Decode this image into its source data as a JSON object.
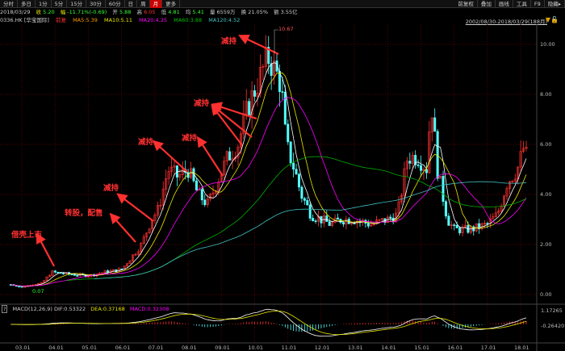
{
  "toolbar": {
    "periods": [
      "分时",
      "多日",
      "1分",
      "5分",
      "15分",
      "30分",
      "60分",
      "日",
      "周",
      "月",
      "更多"
    ],
    "active": "月",
    "right": [
      "前复权",
      "叠加",
      "画线",
      "工具",
      "F9",
      "隐藏▸"
    ]
  },
  "info": {
    "date": "2018/03/29",
    "close_label": "收",
    "close": "5.20",
    "change_label": "幅",
    "change": "-11.71%(-0.69)",
    "open_label": "开",
    "open": "5.88",
    "high_label": "高",
    "high": "6.05",
    "low_label": "低",
    "low": "4.81",
    "avg_label": "均",
    "avg": "5.41",
    "vol_label": "量",
    "vol": "6559万",
    "turn_label": "换",
    "turnover": "21.05%",
    "amt_label": "额",
    "amount": "3.55亿"
  },
  "ma_bar": {
    "code": "0336.HK [华宝国际]",
    "adj": "前复",
    "ma5": "MA5:5.39",
    "ma10": "MA10:5.11",
    "ma20": "MA20:4.25",
    "ma60": "MA60:3.88",
    "ma120": "MA120:4.52"
  },
  "range": "2002/08/30-2018/03/29(188月)",
  "macd": {
    "help": "?",
    "label": "MACD(12,26,9) DIF:0.53322",
    "dea": "DEA:0.37168",
    "macd": "MACD:0.32308",
    "axis": [
      "1.17265",
      "-0.26420"
    ]
  },
  "colors": {
    "up": "#ff3232",
    "down": "#54ffff",
    "ma5": "#ffffff",
    "ma10": "#e8e800",
    "ma20": "#ff00ff",
    "ma60": "#00b000",
    "ma120": "#40c0c0",
    "grid": "#5a0000"
  },
  "chart_data": {
    "type": "candlestick",
    "y_ticks": [
      "10.00",
      "8.00",
      "6.00",
      "4.00",
      "2.00",
      "0.00"
    ],
    "ylim": [
      0,
      11.6
    ],
    "x_ticks": [
      "03.01",
      "04.01",
      "05.01",
      "06.01",
      "07.01",
      "08.01",
      "09.01",
      "10.01",
      "11.01",
      "12.01",
      "13.01",
      "14.01",
      "15.01",
      "16.01",
      "17.01",
      "18.01"
    ],
    "high_label": "10.67",
    "low_label": "0.07",
    "close_anchors": [
      [
        2002.67,
        0.4
      ],
      [
        2003.0,
        0.3
      ],
      [
        2003.3,
        0.4
      ],
      [
        2003.6,
        0.45
      ],
      [
        2003.9,
        0.9
      ],
      [
        2004.5,
        0.8
      ],
      [
        2005.0,
        0.75
      ],
      [
        2005.5,
        0.9
      ],
      [
        2006.0,
        1.0
      ],
      [
        2006.3,
        1.5
      ],
      [
        2006.6,
        2.0
      ],
      [
        2006.9,
        3.0
      ],
      [
        2007.1,
        3.4
      ],
      [
        2007.4,
        5.0
      ],
      [
        2007.7,
        4.7
      ],
      [
        2008.0,
        5.0
      ],
      [
        2008.3,
        4.0
      ],
      [
        2008.6,
        3.6
      ],
      [
        2008.9,
        4.6
      ],
      [
        2009.2,
        5.5
      ],
      [
        2009.5,
        6.0
      ],
      [
        2009.8,
        7.5
      ],
      [
        2010.1,
        8.5
      ],
      [
        2010.4,
        9.5
      ],
      [
        2010.6,
        9.0
      ],
      [
        2010.8,
        8.4
      ],
      [
        2010.95,
        6.0
      ],
      [
        2011.2,
        5.0
      ],
      [
        2011.4,
        4.0
      ],
      [
        2011.7,
        3.2
      ],
      [
        2012.0,
        3.0
      ],
      [
        2012.3,
        2.8
      ],
      [
        2012.6,
        3.0
      ],
      [
        2013.0,
        3.0
      ],
      [
        2013.5,
        2.8
      ],
      [
        2014.0,
        3.0
      ],
      [
        2014.3,
        3.2
      ],
      [
        2014.6,
        5.5
      ],
      [
        2014.9,
        5.5
      ],
      [
        2015.2,
        5.0
      ],
      [
        2015.3,
        8.0
      ],
      [
        2015.5,
        5.0
      ],
      [
        2015.8,
        3.0
      ],
      [
        2016.0,
        2.6
      ],
      [
        2016.5,
        2.6
      ],
      [
        2017.0,
        2.8
      ],
      [
        2017.3,
        3.2
      ],
      [
        2017.6,
        4.5
      ],
      [
        2017.9,
        5.0
      ],
      [
        2018.1,
        5.9
      ],
      [
        2018.25,
        5.2
      ]
    ],
    "annotations": [
      "借壳上市",
      "转股，配售",
      "减持",
      "减持",
      "减持",
      "减持",
      "减持"
    ]
  }
}
